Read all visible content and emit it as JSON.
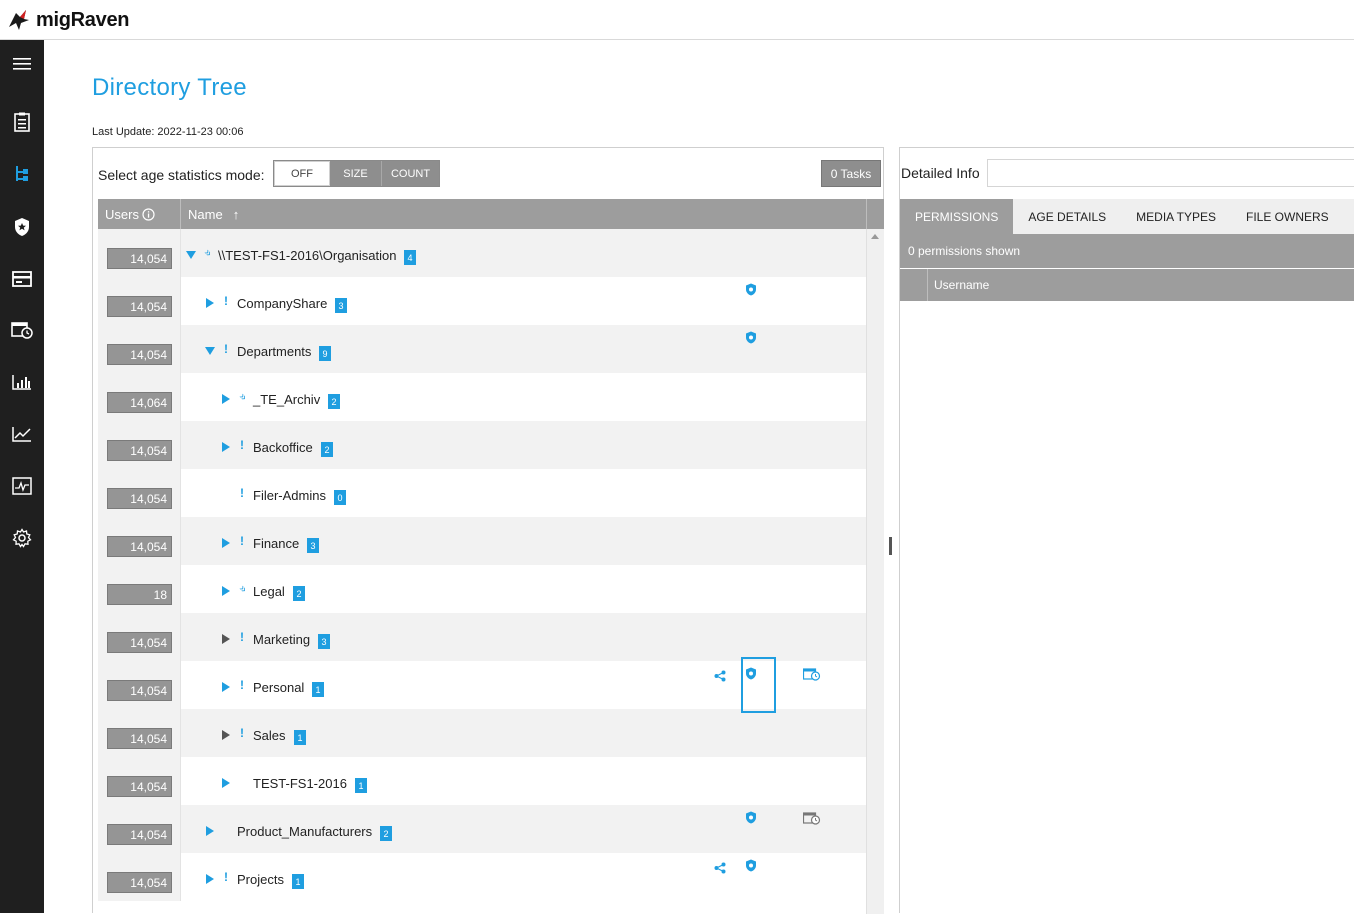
{
  "app": {
    "name": "migRaven"
  },
  "page": {
    "title": "Directory Tree",
    "last_update": "Last Update: 2022-11-23 00:06"
  },
  "sidebar": {
    "items": [
      {
        "icon": "hamburger-menu-icon"
      },
      {
        "icon": "report-clipboard-icon"
      },
      {
        "icon": "directory-tree-icon",
        "active": true
      },
      {
        "icon": "shield-icon"
      },
      {
        "icon": "card-icon"
      },
      {
        "icon": "scheduled-task-icon"
      },
      {
        "icon": "bar-chart-icon"
      },
      {
        "icon": "line-chart-icon"
      },
      {
        "icon": "activity-monitor-icon"
      },
      {
        "icon": "settings-gear-icon"
      }
    ]
  },
  "toolbar": {
    "mode_label": "Select age statistics mode:",
    "modes": [
      "OFF",
      "SIZE",
      "COUNT"
    ],
    "active_mode": "OFF",
    "tasks_label": "0 Tasks"
  },
  "tree": {
    "header": {
      "users": "Users",
      "name": "Name",
      "sort_indicator": "↑"
    },
    "rows": [
      {
        "users": "14,054",
        "name": "\\\\TEST-FS1-2016\\Organisation",
        "count": "4",
        "level": 0,
        "expand": "down",
        "mark": "chevron",
        "icons": []
      },
      {
        "users": "14,054",
        "name": "CompanyShare",
        "count": "3",
        "level": 1,
        "expand": "right",
        "mark": "!",
        "icons": [
          "shield"
        ]
      },
      {
        "users": "14,054",
        "name": "Departments",
        "count": "9",
        "level": 1,
        "expand": "down",
        "mark": "!",
        "icons": [
          "shield"
        ]
      },
      {
        "users": "14,064",
        "name": "_TE_Archiv",
        "count": "2",
        "level": 2,
        "expand": "right",
        "mark": "chevron",
        "icons": []
      },
      {
        "users": "14,054",
        "name": "Backoffice",
        "count": "2",
        "level": 2,
        "expand": "right",
        "mark": "!",
        "icons": []
      },
      {
        "users": "14,054",
        "name": "Filer-Admins",
        "count": "0",
        "level": 2,
        "expand": "none",
        "mark": "!",
        "icons": []
      },
      {
        "users": "14,054",
        "name": "Finance",
        "count": "3",
        "level": 2,
        "expand": "right",
        "mark": "!",
        "icons": []
      },
      {
        "users": "18",
        "name": "Legal",
        "count": "2",
        "level": 2,
        "expand": "right",
        "mark": "chevron",
        "icons": []
      },
      {
        "users": "14,054",
        "name": "Marketing",
        "count": "3",
        "level": 2,
        "expand": "right-gray",
        "mark": "!",
        "icons": []
      },
      {
        "users": "14,054",
        "name": "Personal",
        "count": "1",
        "level": 2,
        "expand": "right",
        "mark": "!",
        "icons": [
          "share",
          "shield",
          "schedule"
        ]
      },
      {
        "users": "14,054",
        "name": "Sales",
        "count": "1",
        "level": 2,
        "expand": "right-gray",
        "mark": "!",
        "icons": []
      },
      {
        "users": "14,054",
        "name": "TEST-FS1-2016",
        "count": "1",
        "level": 2,
        "expand": "right",
        "mark": "",
        "icons": []
      },
      {
        "users": "14,054",
        "name": "Product_Manufacturers",
        "count": "2",
        "level": 1,
        "expand": "right",
        "mark": "",
        "icons": [
          "shield",
          "schedule-gray"
        ]
      },
      {
        "users": "14,054",
        "name": "Projects",
        "count": "1",
        "level": 1,
        "expand": "right",
        "mark": "!",
        "icons": [
          "share",
          "shield"
        ]
      }
    ]
  },
  "detail": {
    "label": "Detailed Info",
    "tabs": [
      "PERMISSIONS",
      "AGE DETAILS",
      "MEDIA TYPES",
      "FILE OWNERS"
    ],
    "active_tab": "PERMISSIONS",
    "summary": "0 permissions shown",
    "column": "Username"
  },
  "colors": {
    "accent": "#1f9ee0",
    "header_gray": "#9d9d9d",
    "sidebar": "#1f1f1f"
  }
}
